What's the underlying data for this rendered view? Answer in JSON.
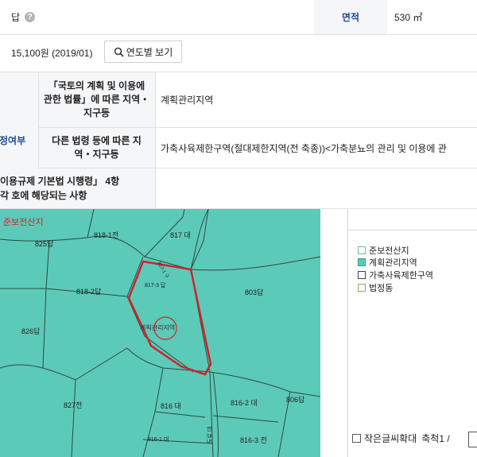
{
  "row1": {
    "category": "답",
    "help_icon": "?",
    "area_label": "면적",
    "area_value": "530 ㎡"
  },
  "row2": {
    "price": "15,100원 (2019/01)",
    "yearly_button": "연도별 보기"
  },
  "zoning": {
    "section_label": "정여부",
    "national_law_label": "「국토의 계획 및 이용에 관한 법률」에 따른 지역・지구등",
    "national_law_value": "계획관리지역",
    "other_law_label": "다른 법령 등에 따른 지역・지구등",
    "other_law_value": "가축사육제한구역(절대제한지역(전 축종))<가축분뇨의 관리 및 이용에 관",
    "regulation_label": "이용규제 기본법 시행령」 4항 각 호에 해당되는 사항",
    "regulation_value": ""
  },
  "map": {
    "corner_label": "준보전산지",
    "parcels": [
      "825답",
      "818-1전",
      "817 대",
      "803답",
      "818-2답",
      "817-3 답",
      "826답",
      "계획관리지역",
      "827전",
      "816 대",
      "816-2 대",
      "806답",
      "816-1 대",
      "816-3 전"
    ],
    "small_labels": [
      "817-1 구",
      "도로 대"
    ]
  },
  "legend": {
    "items": [
      {
        "label": "준보전산지",
        "color": "#ffffff",
        "border": "#6cbf9c"
      },
      {
        "label": "계획관리지역",
        "color": "#5ccab8",
        "border": "#3a9d8e"
      },
      {
        "label": "가축사육제한구역",
        "color": "#ffffff",
        "border": "#444444"
      },
      {
        "label": "법정동",
        "color": "#ffffff",
        "border": "#b19a5c"
      }
    ],
    "small_text_label": "작은글씨확대",
    "scale_label": "축척1 /"
  }
}
